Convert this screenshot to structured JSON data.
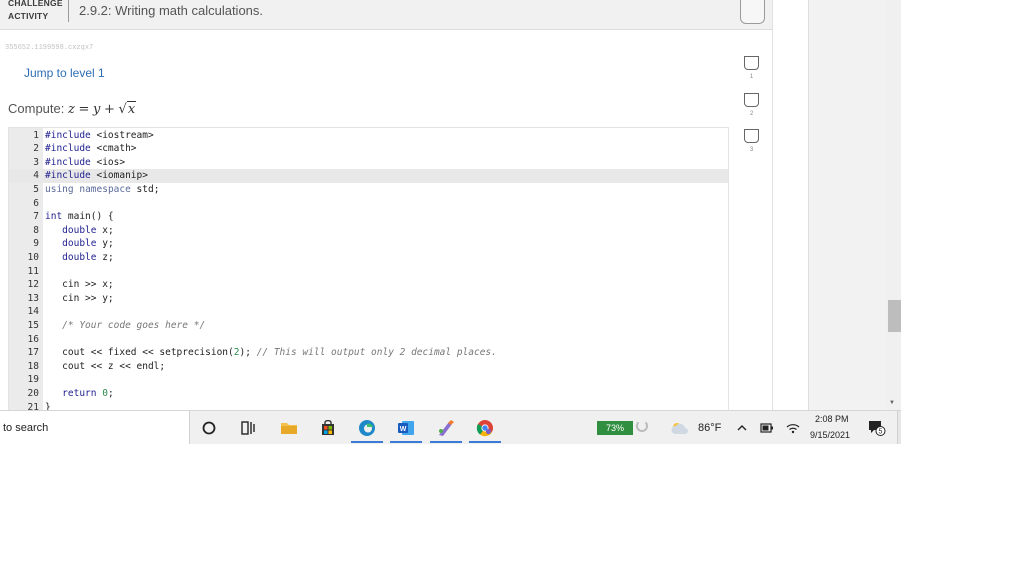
{
  "activity": {
    "type_line1": "CHALLENGE",
    "type_line2": "ACTIVITY",
    "title": "2.9.2: Writing math calculations.",
    "id": "355652.1199598.cxzqx7"
  },
  "jump_link": "Jump to level 1",
  "compute": {
    "label": "Compute:",
    "lhs": "z",
    "eq": "=",
    "y": "y",
    "plus": "+",
    "sqrt_symbol": "√",
    "radicand": "x"
  },
  "editor": {
    "active_line": 4,
    "lines": [
      {
        "n": "1",
        "code": "#include <iostream>"
      },
      {
        "n": "2",
        "code": "#include <cmath>"
      },
      {
        "n": "3",
        "code": "#include <ios>"
      },
      {
        "n": "4",
        "code": "#include <iomanip>"
      },
      {
        "n": "5",
        "code": "using namespace std;"
      },
      {
        "n": "6",
        "code": ""
      },
      {
        "n": "7",
        "code": "int main() {"
      },
      {
        "n": "8",
        "code": "   double x;"
      },
      {
        "n": "9",
        "code": "   double y;"
      },
      {
        "n": "10",
        "code": "   double z;"
      },
      {
        "n": "11",
        "code": ""
      },
      {
        "n": "12",
        "code": "   cin >> x;"
      },
      {
        "n": "13",
        "code": "   cin >> y;"
      },
      {
        "n": "14",
        "code": ""
      },
      {
        "n": "15",
        "code": "   /* Your code goes here */"
      },
      {
        "n": "16",
        "code": ""
      },
      {
        "n": "17",
        "code": "   cout << fixed << setprecision(2); // This will output only 2 decimal places."
      },
      {
        "n": "18",
        "code": "   cout << z << endl;"
      },
      {
        "n": "19",
        "code": ""
      },
      {
        "n": "20",
        "code": "   return 0;"
      },
      {
        "n": "21",
        "code": "}"
      }
    ]
  },
  "levels": [
    {
      "number": "1"
    },
    {
      "number": "2"
    },
    {
      "number": "3"
    }
  ],
  "taskbar": {
    "search_text": "to search",
    "battery_percent": "73%",
    "temperature": "86°F",
    "time": "2:08 PM",
    "date": "9/15/2021",
    "notification_count": "5",
    "app_icons": [
      "cortana-icon",
      "task-view-icon",
      "file-explorer-icon",
      "store-icon",
      "edge-icon",
      "word-icon",
      "paint-icon",
      "chrome-icon"
    ]
  },
  "colors": {
    "link": "#2e6db4",
    "battery": "#2f8f3f",
    "taskbar_accent": "#3d7ad6"
  }
}
